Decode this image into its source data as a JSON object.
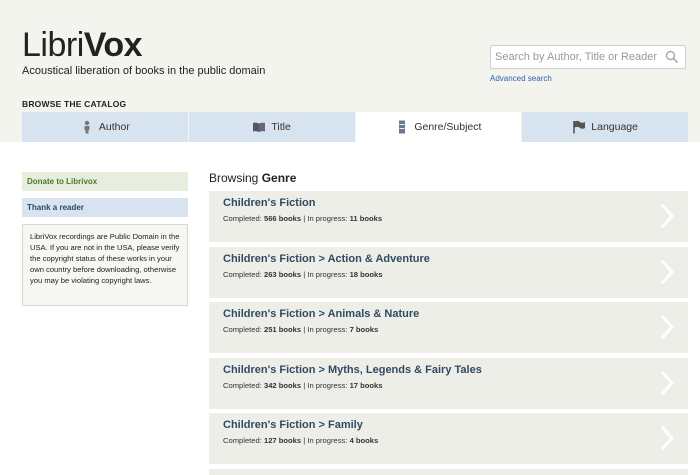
{
  "header": {
    "logo_prefix": "Libri",
    "logo_suffix": "Vox",
    "tagline": "Acoustical liberation of books in the public domain",
    "search_placeholder": "Search by Author, Title or Reader",
    "advanced_search": "Advanced search"
  },
  "catalog": {
    "label": "BROWSE THE CATALOG",
    "tabs": [
      {
        "label": "Author",
        "icon": "person-icon"
      },
      {
        "label": "Title",
        "icon": "book-icon"
      },
      {
        "label": "Genre/Subject",
        "icon": "bookshelf-icon",
        "active": true
      },
      {
        "label": "Language",
        "icon": "flag-icon"
      }
    ]
  },
  "sidebar": {
    "donate": "Donate to Librivox",
    "thank": "Thank a reader",
    "notice": "LibriVox recordings are Public Domain in the USA. If you are not in the USA, please verify the copyright status of these works in your own country before downloading, otherwise you may be violating copyright laws."
  },
  "main": {
    "browsing_prefix": "Browsing",
    "browsing_type": "Genre",
    "completed_label": "Completed:",
    "inprogress_label": "| In progress:",
    "genres": [
      {
        "title": "Children's Fiction",
        "completed": "566 books",
        "in_progress": "11 books"
      },
      {
        "title": "Children's Fiction > Action & Adventure",
        "completed": "263 books",
        "in_progress": "18 books"
      },
      {
        "title": "Children's Fiction > Animals & Nature",
        "completed": "251 books",
        "in_progress": "7 books"
      },
      {
        "title": "Children's Fiction > Myths, Legends & Fairy Tales",
        "completed": "342 books",
        "in_progress": "17 books"
      },
      {
        "title": "Children's Fiction > Family",
        "completed": "127 books",
        "in_progress": "4 books"
      }
    ]
  },
  "colors": {
    "header_bg": "#f4f4ef",
    "tab_bg": "#d7e3ee",
    "genre_title": "#2f4a63",
    "donate_text": "#4d7a24",
    "link": "#2f5fa8"
  }
}
